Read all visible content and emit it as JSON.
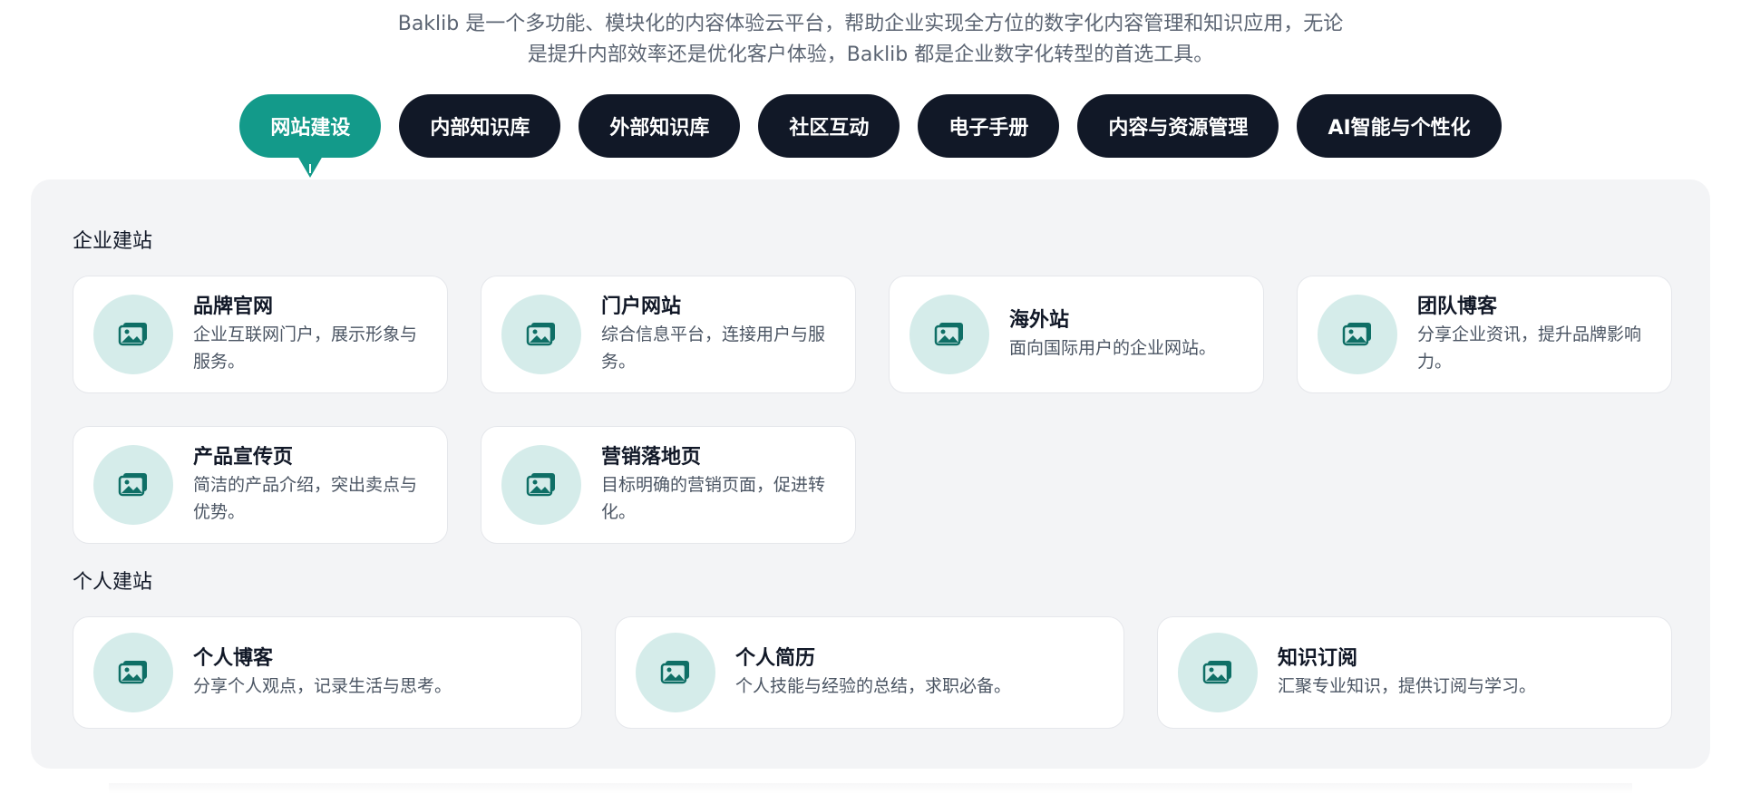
{
  "intro": {
    "line1": "Baklib 是一个多功能、模块化的内容体验云平台，帮助企业实现全方位的数字化内容管理和知识应用，无论",
    "line2": "是提升内部效率还是优化客户体验，Baklib 都是企业数字化转型的首选工具。"
  },
  "tabs": [
    {
      "label": "网站建设",
      "active": true
    },
    {
      "label": "内部知识库"
    },
    {
      "label": "外部知识库"
    },
    {
      "label": "社区互动"
    },
    {
      "label": "电子手册"
    },
    {
      "label": "内容与资源管理"
    },
    {
      "label": "AI智能与个性化"
    }
  ],
  "sections": {
    "enterprise": {
      "title": "企业建站",
      "cards": [
        {
          "title": "品牌官网",
          "desc": "企业互联网门户，展示形象与服务。",
          "icon": "photo-stack-icon"
        },
        {
          "title": "门户网站",
          "desc": "综合信息平台，连接用户与服务。",
          "icon": "photo-stack-icon"
        },
        {
          "title": "海外站",
          "desc": "面向国际用户的企业网站。",
          "icon": "photo-stack-icon"
        },
        {
          "title": "团队博客",
          "desc": "分享企业资讯，提升品牌影响力。",
          "icon": "photo-stack-icon"
        },
        {
          "title": "产品宣传页",
          "desc": "简洁的产品介绍，突出卖点与优势。",
          "icon": "photo-stack-icon"
        },
        {
          "title": "营销落地页",
          "desc": "目标明确的营销页面，促进转化。",
          "icon": "photo-stack-icon"
        }
      ]
    },
    "personal": {
      "title": "个人建站",
      "cards": [
        {
          "title": "个人博客",
          "desc": "分享个人观点，记录生活与思考。",
          "icon": "photo-stack-icon"
        },
        {
          "title": "个人简历",
          "desc": "个人技能与经验的总结，求职必备。",
          "icon": "photo-stack-icon"
        },
        {
          "title": "知识订阅",
          "desc": "汇聚专业知识，提供订阅与学习。",
          "icon": "photo-stack-icon"
        }
      ]
    }
  },
  "colors": {
    "accent": "#139a8a",
    "tab_dark": "#111827",
    "icon_bg": "#d5ecea",
    "icon_fg": "#0f6f66",
    "panel_bg": "#f3f4f6"
  }
}
